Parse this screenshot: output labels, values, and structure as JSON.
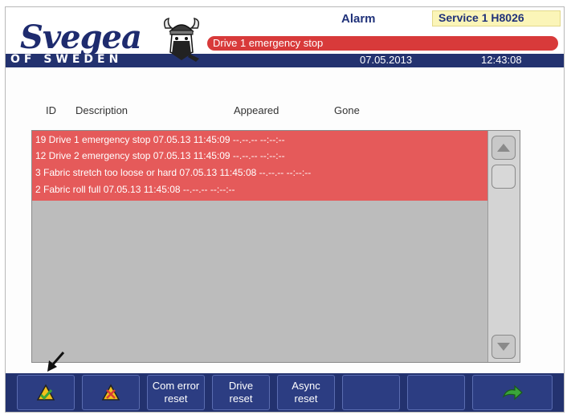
{
  "header": {
    "logo_text": "Svegea",
    "logo_sub": "OF SWEDEN",
    "screen_title": "Alarm",
    "service_label": "Service 1 H8026",
    "active_alarm": "Drive 1 emergency stop",
    "date": "07.05.2013",
    "time": "12:43:08"
  },
  "columns": {
    "id": "ID",
    "description": "Description",
    "appeared": "Appeared",
    "gone": "Gone"
  },
  "alarms": [
    {
      "text": "19 Drive 1 emergency stop 07.05.13 11:45:09 --.--.-- --:--:--"
    },
    {
      "text": "12 Drive 2 emergency stop 07.05.13 11:45:09 --.--.-- --:--:--"
    },
    {
      "text": "3 Fabric stretch too loose or hard 07.05.13 11:45:08 --.--.-- --:--:--"
    },
    {
      "text": "2 Fabric roll full 07.05.13 11:45:08 --.--.-- --:--:--"
    }
  ],
  "toolbar": {
    "btn1_icon": "warning-acknowledge-icon",
    "btn2_icon": "warning-list-icon",
    "com_error_reset_line1": "Com error",
    "com_error_reset_line2": "reset",
    "drive_reset_line1": "Drive",
    "drive_reset_line2": "reset",
    "async_reset_line1": "Async",
    "async_reset_line2": "reset",
    "btn_last_icon": "next-arrow-icon"
  },
  "colors": {
    "brand_blue": "#23326f",
    "alarm_red": "#e55a5a",
    "service_bg": "#fbf5b8"
  }
}
